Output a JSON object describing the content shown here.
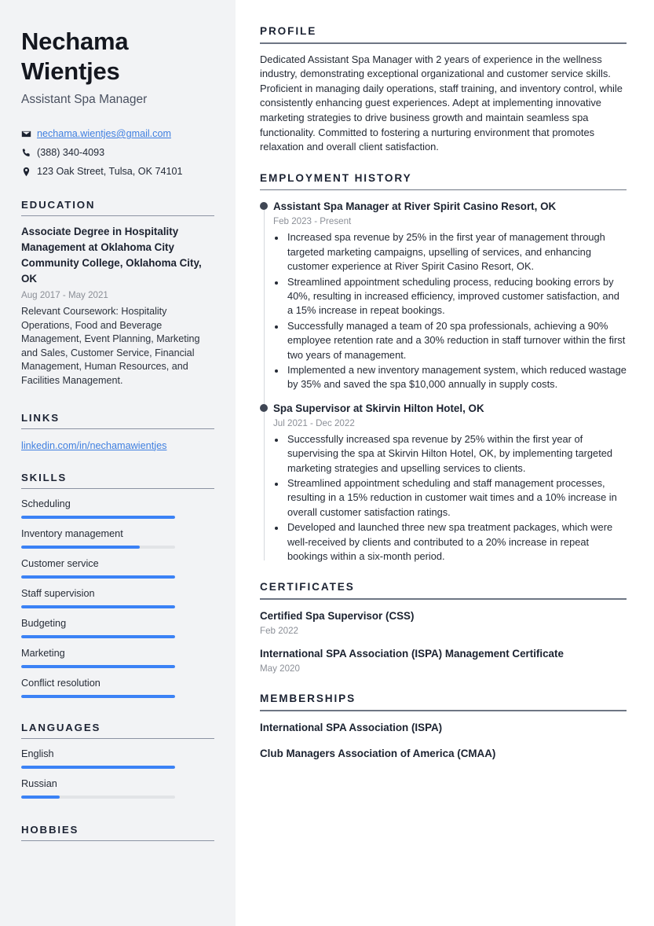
{
  "sidebar": {
    "name": "Nechama Wientjes",
    "job_title": "Assistant Spa Manager",
    "contacts": [
      {
        "icon": "envelope-icon",
        "text": "nechama.wientjes@gmail.com",
        "is_link": true
      },
      {
        "icon": "phone-icon",
        "text": "(388) 340-4093",
        "is_link": false
      },
      {
        "icon": "map-pin-icon",
        "text": "123 Oak Street, Tulsa, OK 74101",
        "is_link": false
      }
    ],
    "education": {
      "heading": "EDUCATION",
      "entries": [
        {
          "title": "Associate Degree in Hospitality Management at Oklahoma City Community College, Oklahoma City, OK",
          "date": "Aug 2017 - May 2021",
          "description": "Relevant Coursework: Hospitality Operations, Food and Beverage Management, Event Planning, Marketing and Sales, Customer Service, Financial Management, Human Resources, and Facilities Management."
        }
      ]
    },
    "links": {
      "heading": "LINKS",
      "items": [
        {
          "label": "linkedin.com/in/nechamawientjes"
        }
      ]
    },
    "skills": {
      "heading": "SKILLS",
      "items": [
        {
          "label": "Scheduling",
          "level": 100
        },
        {
          "label": "Inventory management",
          "level": 77
        },
        {
          "label": "Customer service",
          "level": 100
        },
        {
          "label": "Staff supervision",
          "level": 100
        },
        {
          "label": "Budgeting",
          "level": 100
        },
        {
          "label": "Marketing",
          "level": 100
        },
        {
          "label": "Conflict resolution",
          "level": 100
        }
      ]
    },
    "languages": {
      "heading": "LANGUAGES",
      "items": [
        {
          "label": "English",
          "level": 100
        },
        {
          "label": "Russian",
          "level": 25
        }
      ]
    },
    "hobbies": {
      "heading": "HOBBIES"
    }
  },
  "main": {
    "profile": {
      "heading": "PROFILE",
      "text": "Dedicated Assistant Spa Manager with 2 years of experience in the wellness industry, demonstrating exceptional organizational and customer service skills. Proficient in managing daily operations, staff training, and inventory control, while consistently enhancing guest experiences. Adept at implementing innovative marketing strategies to drive business growth and maintain seamless spa functionality. Committed to fostering a nurturing environment that promotes relaxation and overall client satisfaction."
    },
    "employment": {
      "heading": "EMPLOYMENT HISTORY",
      "jobs": [
        {
          "title": "Assistant Spa Manager at River Spirit Casino Resort, OK",
          "date": "Feb 2023 - Present",
          "bullets": [
            "Increased spa revenue by 25% in the first year of management through targeted marketing campaigns, upselling of services, and enhancing customer experience at River Spirit Casino Resort, OK.",
            "Streamlined appointment scheduling process, reducing booking errors by 40%, resulting in increased efficiency, improved customer satisfaction, and a 15% increase in repeat bookings.",
            "Successfully managed a team of 20 spa professionals, achieving a 90% employee retention rate and a 30% reduction in staff turnover within the first two years of management.",
            "Implemented a new inventory management system, which reduced wastage by 35% and saved the spa $10,000 annually in supply costs."
          ]
        },
        {
          "title": "Spa Supervisor at Skirvin Hilton Hotel, OK",
          "date": "Jul 2021 - Dec 2022",
          "bullets": [
            "Successfully increased spa revenue by 25% within the first year of supervising the spa at Skirvin Hilton Hotel, OK, by implementing targeted marketing strategies and upselling services to clients.",
            "Streamlined appointment scheduling and staff management processes, resulting in a 15% reduction in customer wait times and a 10% increase in overall customer satisfaction ratings.",
            "Developed and launched three new spa treatment packages, which were well-received by clients and contributed to a 20% increase in repeat bookings within a six-month period."
          ]
        }
      ]
    },
    "certificates": {
      "heading": "CERTIFICATES",
      "items": [
        {
          "title": "Certified Spa Supervisor (CSS)",
          "date": "Feb 2022"
        },
        {
          "title": "International SPA Association (ISPA) Management Certificate",
          "date": "May 2020"
        }
      ]
    },
    "memberships": {
      "heading": "MEMBERSHIPS",
      "items": [
        {
          "title": "International SPA Association (ISPA)"
        },
        {
          "title": "Club Managers Association of America (CMAA)"
        }
      ]
    }
  },
  "colors": {
    "accent": "#3b82f6",
    "link": "#3f7fe0",
    "sidebar_bg": "#f2f3f5",
    "heading": "#1c2333",
    "muted": "#8b8f97"
  }
}
